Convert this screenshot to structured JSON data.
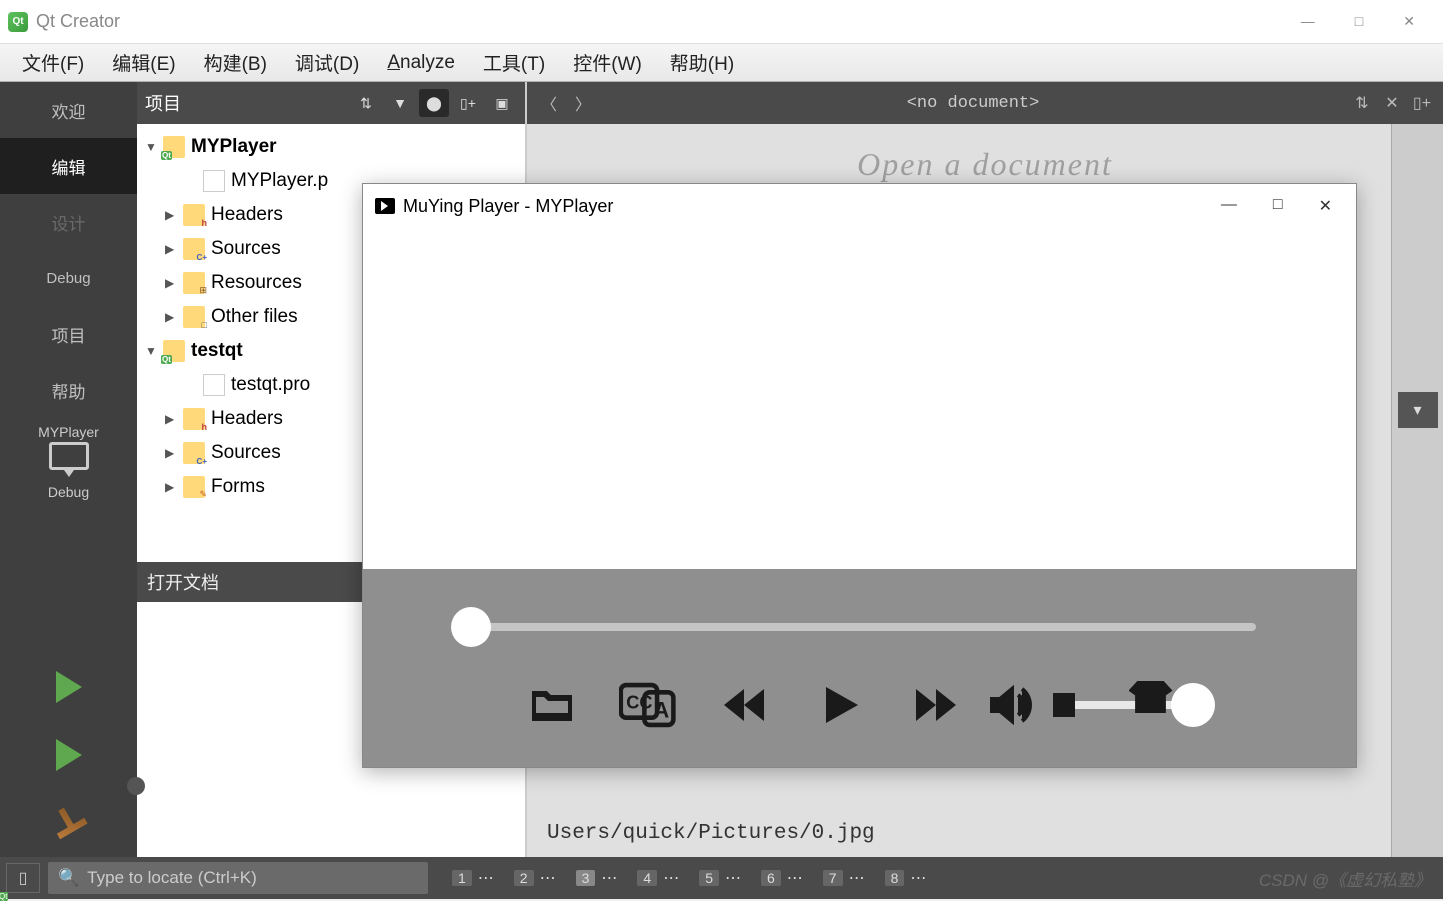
{
  "window": {
    "title": "Qt Creator",
    "minimize": "—",
    "maximize": "□",
    "close": "✕"
  },
  "menu": {
    "file": "文件(F)",
    "edit": "编辑(E)",
    "build": "构建(B)",
    "debug": "调试(D)",
    "analyze": "Analyze",
    "tools": "工具(T)",
    "widgets": "控件(W)",
    "help": "帮助(H)"
  },
  "sidebar": {
    "welcome": "欢迎",
    "edit": "编辑",
    "design": "设计",
    "debug": "Debug",
    "projects": "项目",
    "help": "帮助",
    "kit": "MYPlayer",
    "kitmode": "Debug"
  },
  "projectPane": {
    "header": "项目",
    "docsHeader": "打开文档",
    "tree": {
      "p1": "MYPlayer",
      "p1file": "MYPlayer.p",
      "headers": "Headers",
      "sources": "Sources",
      "resources": "Resources",
      "other": "Other files",
      "p2": "testqt",
      "p2file": "testqt.pro",
      "forms": "Forms"
    }
  },
  "editor": {
    "noDoc": "<no document>",
    "openDoc": "Open a document",
    "hiddenPath": "Users/quick/Pictures/0.jpg"
  },
  "search": {
    "placeholder": "Type to locate (Ctrl+K)"
  },
  "outputTabs": [
    "1",
    "2",
    "3",
    "4",
    "5",
    "6",
    "7",
    "8"
  ],
  "player": {
    "title": "MuYing Player - MYPlayer"
  },
  "watermark": "CSDN @《虚幻私塾》"
}
